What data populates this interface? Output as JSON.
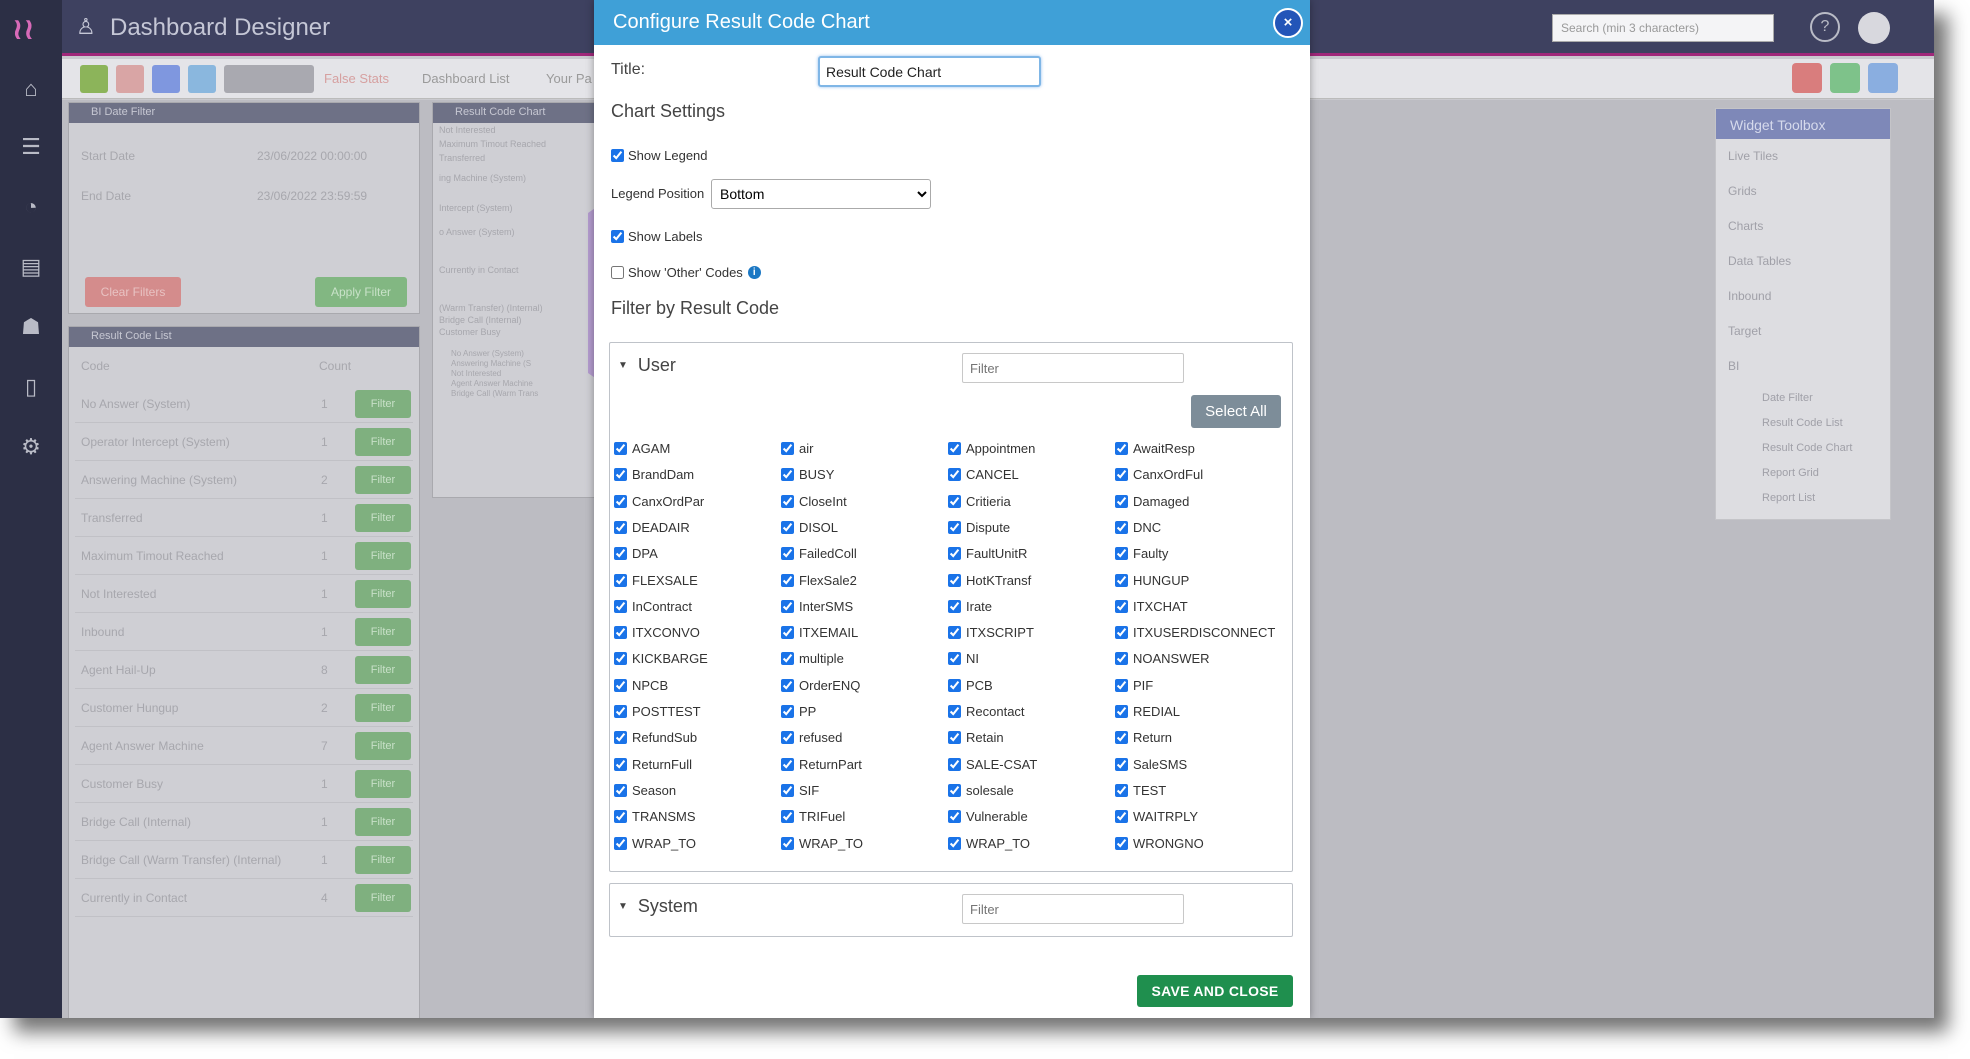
{
  "background": {
    "app_title": "Dashboard Designer",
    "search_placeholder": "Search (min 3 characters)",
    "toolbar_texts": [
      "False Stats",
      "Dashboard List",
      "Your Pa"
    ],
    "date_panel": {
      "title": "BI Date Filter",
      "start_label": "Start Date",
      "start_value": "23/06/2022 00:00:00",
      "end_label": "End Date",
      "end_value": "23/06/2022 23:59:59",
      "clear_label": "Clear Filters",
      "apply_label": "Apply Filter"
    },
    "list_panel": {
      "title": "Result Code List",
      "col_code": "Code",
      "col_count": "Count",
      "filter_label": "Filter",
      "rows": [
        {
          "code": "No Answer (System)",
          "count": "1"
        },
        {
          "code": "Operator Intercept (System)",
          "count": "1"
        },
        {
          "code": "Answering Machine (System)",
          "count": "2"
        },
        {
          "code": "Transferred",
          "count": "1"
        },
        {
          "code": "Maximum Timout Reached",
          "count": "1"
        },
        {
          "code": "Not Interested",
          "count": "1"
        },
        {
          "code": "Inbound",
          "count": "1"
        },
        {
          "code": "Agent Hail-Up",
          "count": "8"
        },
        {
          "code": "Customer Hungup",
          "count": "2"
        },
        {
          "code": "Agent Answer Machine",
          "count": "7"
        },
        {
          "code": "Customer Busy",
          "count": "1"
        },
        {
          "code": "Bridge Call (Internal)",
          "count": "1"
        },
        {
          "code": "Bridge Call (Warm Transfer) (Internal)",
          "count": "1"
        },
        {
          "code": "Currently in Contact",
          "count": "4"
        }
      ]
    },
    "chart_panel": {
      "title": "Result Code Chart",
      "labels": [
        "Not Interested",
        "Maximum Timout Reached",
        "Transferred",
        "ing Machine (System)",
        "Intercept (System)",
        "o Answer (System)",
        "Currently in Contact",
        "(Warm Transfer) (Internal)",
        "Bridge Call (Internal)",
        "Customer Busy"
      ],
      "legend": [
        "No Answer (System)",
        "Answering Machine (S",
        "Not Interested",
        "Agent Answer Machine",
        "Bridge Call (Warm Trans"
      ]
    },
    "toolbox": {
      "title": "Widget Toolbox",
      "items": [
        "Live Tiles",
        "Grids",
        "Charts",
        "Data Tables",
        "Inbound",
        "Target",
        "BI"
      ],
      "sub_items": [
        "Date Filter",
        "Result Code List",
        "Result Code Chart",
        "Report Grid",
        "Report List"
      ]
    }
  },
  "modal": {
    "title": "Configure Result Code Chart",
    "close_label": "×",
    "title_label": "Title:",
    "title_value": "Result Code Chart",
    "chart_settings_heading": "Chart Settings",
    "show_legend_label": "Show Legend",
    "show_legend": true,
    "legend_position_label": "Legend Position",
    "legend_position": "Bottom",
    "show_labels_label": "Show Labels",
    "show_labels": true,
    "show_other_label": "Show 'Other' Codes",
    "show_other": false,
    "info_icon_label": "i",
    "filter_heading": "Filter by Result Code",
    "groups": [
      {
        "name": "User",
        "filter_placeholder": "Filter",
        "select_all_label": "Select All",
        "codes": [
          "AGAM",
          "air",
          "Appointmen",
          "AwaitResp",
          "BrandDam",
          "BUSY",
          "CANCEL",
          "CanxOrdFul",
          "CanxOrdPar",
          "CloseInt",
          "Critieria",
          "Damaged",
          "DEADAIR",
          "DISOL",
          "Dispute",
          "DNC",
          "DPA",
          "FailedColl",
          "FaultUnitR",
          "Faulty",
          "FLEXSALE",
          "FlexSale2",
          "HotKTransf",
          "HUNGUP",
          "InContract",
          "InterSMS",
          "Irate",
          "ITXCHAT",
          "ITXCONVO",
          "ITXEMAIL",
          "ITXSCRIPT",
          "ITXUSERDISCONNECT",
          "KICKBARGE",
          "multiple",
          "NI",
          "NOANSWER",
          "NPCB",
          "OrderENQ",
          "PCB",
          "PIF",
          "POSTTEST",
          "PP",
          "Recontact",
          "REDIAL",
          "RefundSub",
          "refused",
          "Retain",
          "Return",
          "ReturnFull",
          "ReturnPart",
          "SALE-CSAT",
          "SaleSMS",
          "Season",
          "SIF",
          "solesale",
          "TEST",
          "TRANSMS",
          "TRIFuel",
          "Vulnerable",
          "WAITRPLY",
          "WRAP_TO",
          "WRAP_TO",
          "WRAP_TO",
          "WRONGNO"
        ]
      },
      {
        "name": "System",
        "filter_placeholder": "Filter"
      }
    ],
    "save_label": "SAVE AND CLOSE"
  }
}
